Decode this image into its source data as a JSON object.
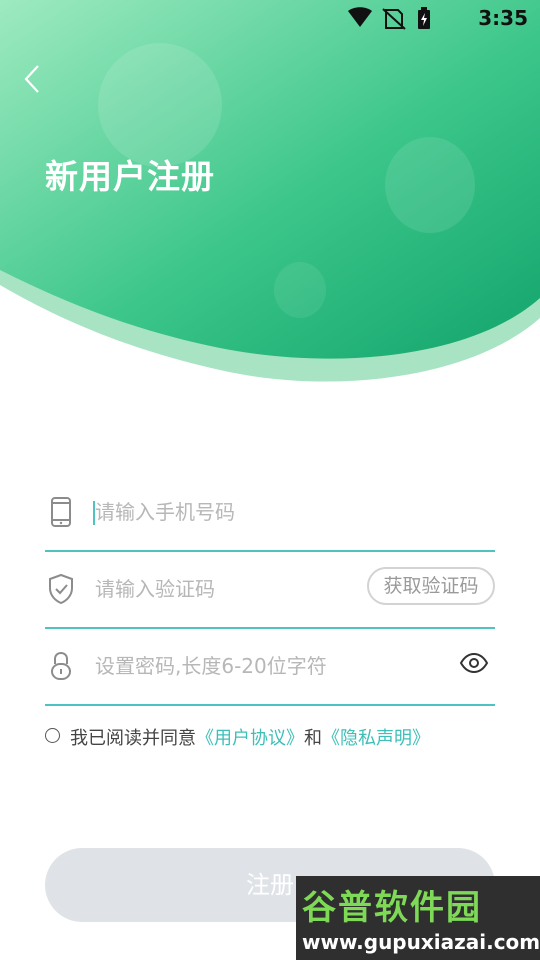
{
  "status_bar": {
    "time": "3:35",
    "icons": [
      "wifi-icon",
      "no-sim-icon",
      "battery-charging-icon"
    ]
  },
  "header": {
    "title": "新用户注册",
    "back_icon": "chevron-left-icon"
  },
  "form": {
    "phone": {
      "placeholder": "请输入手机号码",
      "icon": "phone-icon"
    },
    "code": {
      "placeholder": "请输入验证码",
      "icon": "shield-check-icon",
      "button": "获取验证码"
    },
    "password": {
      "placeholder": "设置密码,长度6-20位字符",
      "icon": "lock-icon",
      "toggle_icon": "eye-icon"
    }
  },
  "agreement": {
    "prefix": "我已阅读并同意",
    "user_agreement": "《用户协议》",
    "conjunction": "和",
    "privacy": "《隐私声明》",
    "checked": false
  },
  "submit": {
    "label": "注册"
  },
  "watermark": {
    "title": "谷普软件园",
    "url": "www.gupuxiazai.com"
  },
  "colors": {
    "accent": "#3dbfb8",
    "gradient_start": "#8fe5b9",
    "gradient_end": "#1fae75",
    "button_disabled": "#dfe3e8"
  }
}
